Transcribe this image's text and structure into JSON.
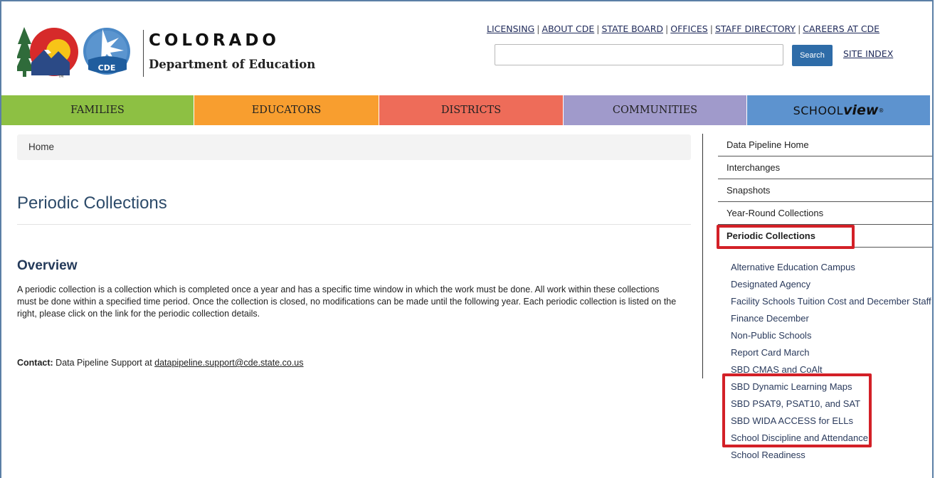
{
  "header": {
    "brand_name": "COLORADO",
    "brand_sub": "Department of Education",
    "logo_badge": "CDE",
    "top_links": [
      "LICENSING",
      "ABOUT CDE",
      "STATE BOARD",
      "OFFICES",
      "STAFF DIRECTORY",
      "CAREERS AT CDE"
    ],
    "search_placeholder": "",
    "search_button": "Search",
    "site_index": "SITE INDEX"
  },
  "nav": {
    "families": "FAMILIES",
    "educators": "EDUCATORS",
    "districts": "DISTRICTS",
    "communities": "COMMUNITIES",
    "schoolview_a": "SCHOOL",
    "schoolview_b": "view",
    "schoolview_reg": "®"
  },
  "breadcrumb": {
    "home": "Home"
  },
  "main": {
    "title": "Periodic Collections",
    "overview_heading": "Overview",
    "overview_text": "A periodic collection is a collection which is completed once a year and has a specific time window in which the work must be done. All work within these collections must be done within a specified time period. Once the collection is closed, no modifications can be made until the following year. Each periodic collection is listed on the right, please click on the link for the periodic collection details.",
    "contact_label": "Contact:",
    "contact_text": " Data Pipeline Support at ",
    "contact_email": "datapipeline.support@cde.state.co.us"
  },
  "sidebar": {
    "items": [
      {
        "label": "Data Pipeline Home"
      },
      {
        "label": "Interchanges"
      },
      {
        "label": "Snapshots"
      },
      {
        "label": "Year-Round Collections"
      },
      {
        "label": "Periodic Collections"
      }
    ],
    "sub_items": [
      {
        "label": "Alternative Education Campus"
      },
      {
        "label": "Designated Agency"
      },
      {
        "label": "Facility Schools Tuition Cost and December Staff"
      },
      {
        "label": "Finance December"
      },
      {
        "label": "Non-Public Schools"
      },
      {
        "label": "Report Card March"
      },
      {
        "label": "SBD CMAS and CoAlt"
      },
      {
        "label": "SBD Dynamic Learning Maps"
      },
      {
        "label": "SBD PSAT9, PSAT10, and SAT"
      },
      {
        "label": "SBD WIDA ACCESS for ELLs"
      },
      {
        "label": "School Discipline and Attendance"
      },
      {
        "label": "School Readiness"
      }
    ]
  },
  "colors": {
    "families": "#8dc043",
    "educators": "#f89e2f",
    "districts": "#ee6c59",
    "communities": "#a09acb",
    "schoolview": "#5d93cf",
    "highlight": "#d32027"
  }
}
